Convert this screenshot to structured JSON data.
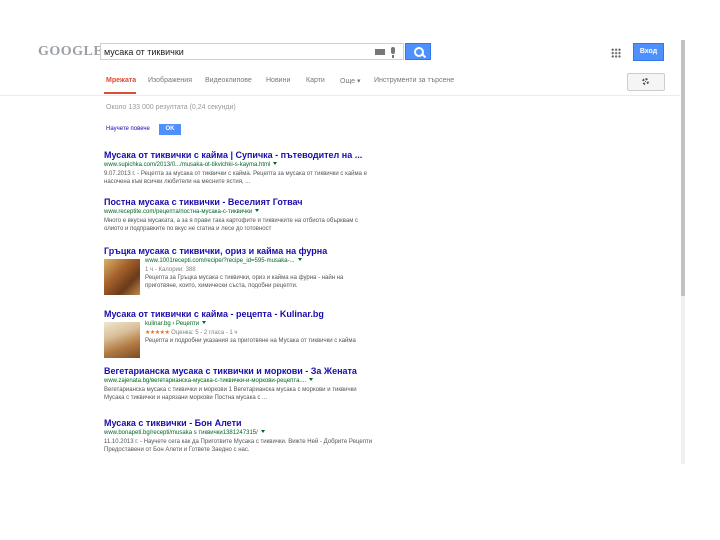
{
  "header": {
    "logo_text": "GOOGLE",
    "search_value": "мусака от тиквички",
    "login_label": "Вход"
  },
  "nav": {
    "tabs": [
      "Мрежата",
      "Изображения",
      "Видеоклипове",
      "Новини",
      "Карти",
      "Още ▾",
      "Инструменти за търсене"
    ]
  },
  "stats": "Около 133 000 резултата (0,24 секунди)",
  "tip": {
    "text": "Научете повече",
    "ok_label": "OK"
  },
  "results": [
    {
      "title": "Мусака от тиквички с кайма | Супичка - пътеводител на ...",
      "url": "www.supichka.com/2013/0.../musaka-ot-tikvichki-s-kayma.html",
      "snippet": "9.07.2013 г. - Рецепта за мусака от тиквички с кайма. Рецепта за мусака от тиквички с кайма е насочена към всички любители на месните ястия, ..."
    },
    {
      "title": "Постна мусака с тиквички - Веселият Готвач",
      "url": "www.receptite.com/рецепта/постна-мусака-с-тиквички",
      "snippet": "Много е вкусна мусаката, а за я прави така картофите и тиквичките на отбиота обърквам с олиото и подправките по вкус не сгатиа и лесе до готовност"
    },
    {
      "title": "Гръцка мусака с тиквички, ориз и кайма на фурна",
      "url": "www.1001recepti.com/recipe/?recipe_id=595-musaka-...",
      "meta": "1 ч - Калории: 388",
      "snippet": "Рецепта за Гръцка мусака с тиквички, ориз и кайма на фурна - найн на приготвяне, които, химически съста, подобни рецепти."
    },
    {
      "title": "Мусака от тиквички с кайма - рецепта - Kulinar.bg",
      "url": "kulinar.bg › Рецепти",
      "meta_stars": "★★★★★",
      "meta": "Оценка: 5 - 2 гласа - 1 ч",
      "snippet": "Рецепта и подробни указания за приготвяне на Мусака от тиквички с кайма"
    },
    {
      "title": "Вегетарианска мусака с тиквички и моркови - За Жената",
      "url": "www.zajenata.bg/вегетарианска-мусака-с-тиквички-и-моркови-рецепта....",
      "snippet": "Вегетарианска мусака с тиквички и моркови 1 Вегетарианска мусака с моркови и тиквички Мусака с тиквички и нарязани моркови Постна мусака с ..."
    },
    {
      "title": "Мусака с тиквички - Бон Алети",
      "url": "www.bonapeti.bg/recepti/musaka s тиквички1381247315/",
      "snippet": "11.10.2013 г. - Научете сега как да Приготвите Мусака с тиквички. Вижте Ней - Добрите Рецепти Предоставени от Бон Алети и Гответе Заедно с нас."
    }
  ]
}
